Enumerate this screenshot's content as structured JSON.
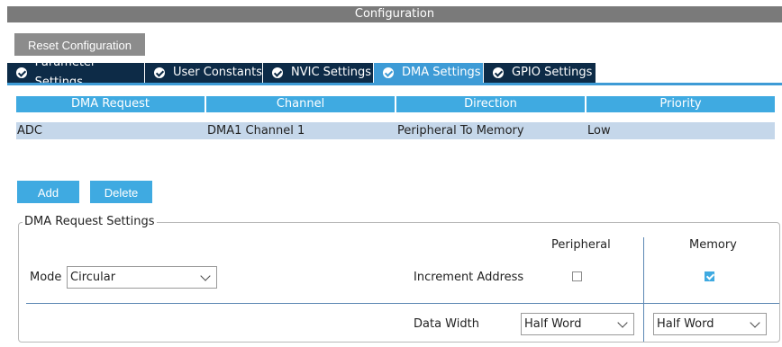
{
  "title": "Configuration",
  "reset_label": "Reset Configuration",
  "tabs": [
    {
      "label": "Parameter Settings",
      "active": false
    },
    {
      "label": "User Constants",
      "active": false
    },
    {
      "label": "NVIC Settings",
      "active": false
    },
    {
      "label": "DMA Settings",
      "active": true
    },
    {
      "label": "GPIO Settings",
      "active": false
    }
  ],
  "table": {
    "headers": [
      "DMA Request",
      "Channel",
      "Direction",
      "Priority"
    ],
    "rows": [
      [
        "ADC",
        "DMA1 Channel 1",
        "Peripheral To Memory",
        "Low"
      ]
    ]
  },
  "buttons": {
    "add": "Add",
    "delete": "Delete"
  },
  "request_settings": {
    "group_title": "DMA Request Settings",
    "mode_label": "Mode",
    "mode_value": "Circular",
    "peripheral_header": "Peripheral",
    "memory_header": "Memory",
    "increment_label": "Increment Address",
    "peripheral_increment": false,
    "memory_increment": true,
    "data_width_label": "Data Width",
    "peripheral_width": "Half Word",
    "memory_width": "Half Word"
  },
  "colors": {
    "accent": "#3faae1",
    "tab_dark": "#0d2b47",
    "row_selected": "#c5d7ea"
  }
}
